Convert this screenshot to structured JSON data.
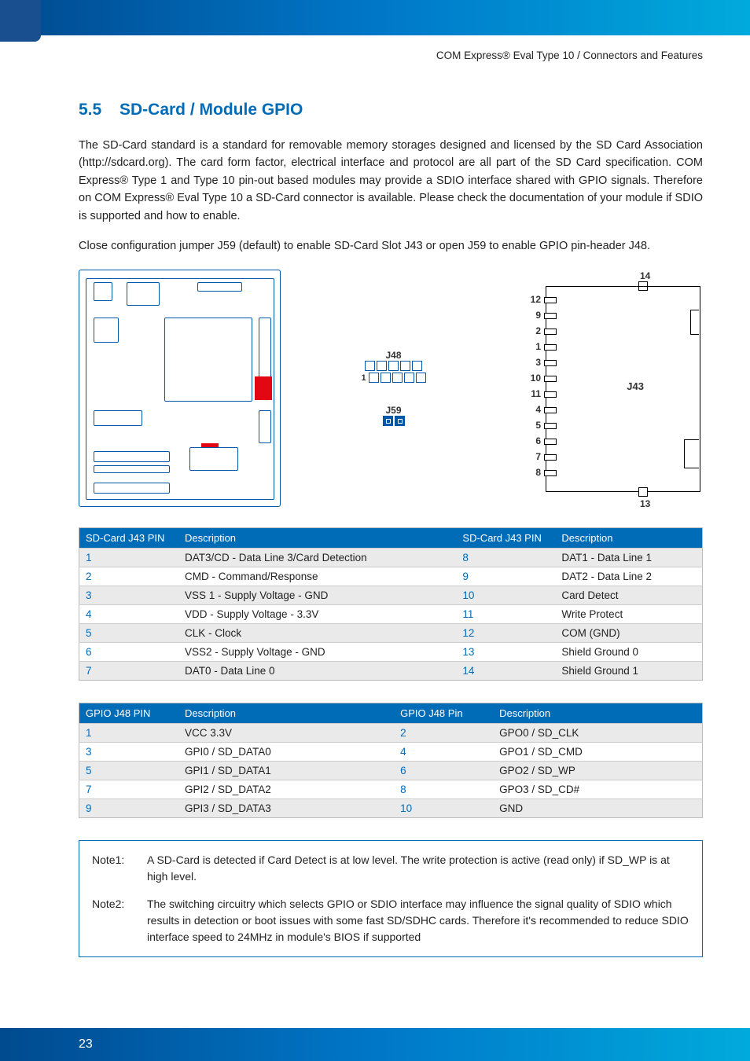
{
  "breadcrumb": "COM Express® Eval Type 10 / Connectors and Features",
  "section_number": "5.5",
  "section_title": "SD-Card / Module GPIO",
  "para1": "The SD-Card standard is a standard for removable memory storages designed and licensed by the SD Card Association (http://sdcard.org). The card form factor, electrical interface and protocol are all part of the SD Card specification. COM Express® Type 1 and Type 10 pin-out based modules may provide a SDIO interface shared with GPIO signals. Therefore on COM Express® Eval Type 10 a SD-Card connector is available. Please check the documentation of your module if SDIO is supported and how to enable.",
  "para2": "Close configuration jumper J59 (default) to enable SD-Card Slot J43 or open J59 to enable GPIO pin-header J48.",
  "diagram": {
    "j48_label": "J48",
    "j59_label": "J59",
    "j43_label": "J43",
    "pin1_label": "1",
    "j43_pins_left": [
      "12",
      "9",
      "2",
      "1",
      "3",
      "10",
      "11",
      "4",
      "5",
      "6",
      "7",
      "8"
    ],
    "j43_top": "14",
    "j43_bottom": "13"
  },
  "table_j43": {
    "headers": [
      "SD-Card J43 PIN",
      "Description",
      "SD-Card J43 PIN",
      "Description"
    ],
    "rows": [
      [
        "1",
        "DAT3/CD - Data Line 3/Card Detection",
        "8",
        "DAT1 - Data Line 1"
      ],
      [
        "2",
        "CMD - Command/Response",
        "9",
        "DAT2 - Data Line 2"
      ],
      [
        "3",
        "VSS 1 - Supply Voltage - GND",
        "10",
        "Card Detect"
      ],
      [
        "4",
        "VDD - Supply Voltage - 3.3V",
        "11",
        "Write Protect"
      ],
      [
        "5",
        "CLK - Clock",
        "12",
        "COM (GND)"
      ],
      [
        "6",
        "VSS2 - Supply Voltage - GND",
        "13",
        "Shield Ground 0"
      ],
      [
        "7",
        "DAT0 - Data Line 0",
        "14",
        "Shield Ground 1"
      ]
    ]
  },
  "table_j48": {
    "headers": [
      "GPIO J48 PIN",
      "Description",
      "GPIO J48 Pin",
      "Description"
    ],
    "rows": [
      [
        "1",
        "VCC 3.3V",
        "2",
        "GPO0 / SD_CLK"
      ],
      [
        "3",
        "GPI0 / SD_DATA0",
        "4",
        "GPO1 / SD_CMD"
      ],
      [
        "5",
        "GPI1 / SD_DATA1",
        "6",
        "GPO2 / SD_WP"
      ],
      [
        "7",
        "GPI2 / SD_DATA2",
        "8",
        "GPO3 / SD_CD#"
      ],
      [
        "9",
        "GPI3 / SD_DATA3",
        "10",
        "GND"
      ]
    ]
  },
  "notes": [
    {
      "label": "Note1:",
      "text": "A SD-Card is detected if Card Detect is at low level. The write protection is active (read only) if SD_WP is at high level."
    },
    {
      "label": "Note2:",
      "text": "The switching circuitry which selects GPIO or SDIO interface may influence the signal quality of SDIO which results in detection or boot issues with some fast SD/SDHC cards. Therefore it's recommended to reduce SDIO interface speed to 24MHz in module's BIOS if supported"
    }
  ],
  "page_number": "23"
}
